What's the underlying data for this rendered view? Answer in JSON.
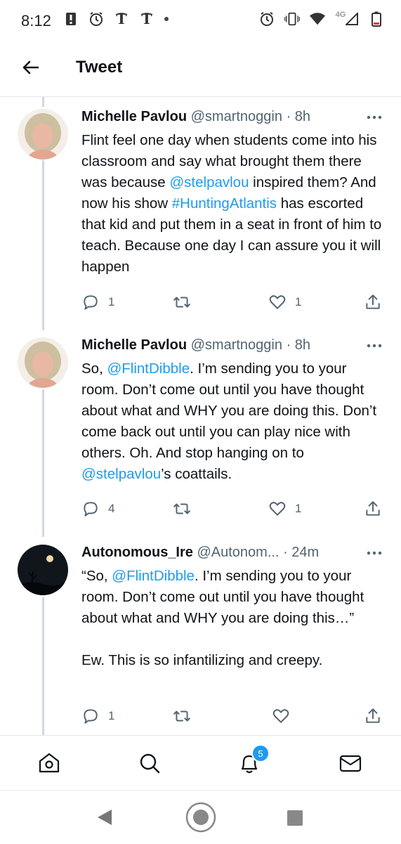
{
  "status_bar": {
    "time": "8:12",
    "icons_left": [
      "alert-icon",
      "alarm-icon",
      "nyt-icon",
      "nyt-icon",
      "dot-icon"
    ],
    "icons_right": [
      "alarm-icon",
      "vibrate-icon",
      "wifi-icon",
      "signal-icon",
      "battery-icon"
    ],
    "network": "4G"
  },
  "header": {
    "title": "Tweet",
    "back_icon": "back-arrow-icon"
  },
  "tweets": [
    {
      "name": "Michelle Pavlou",
      "handle": "@smartnoggin",
      "time": "· 8h",
      "text_parts": [
        "Flint feel one day when students come into his classroom and say what brought them there was because ",
        "@stelpavlou",
        " inspired them? And now his show ",
        "#HuntingAtlantis",
        " has escorted that kid and put them in a seat in front of him to teach. Because one day I can assure you it will happen"
      ],
      "replies": "1",
      "retweets": "",
      "likes": "1"
    },
    {
      "name": "Michelle Pavlou",
      "handle": "@smartnoggin",
      "time": "· 8h",
      "text_parts": [
        "So, ",
        "@FlintDibble",
        ". I’m sending you to your room. Don’t come out until you have thought about what and WHY you are doing this. Don’t come back out until you can play nice with others. Oh. And stop hanging on to ",
        "@stelpavlou",
        "’s coattails."
      ],
      "replies": "4",
      "retweets": "",
      "likes": "1"
    },
    {
      "name": "Autonomous_Ire",
      "handle": "@Autonom...",
      "time": "· 24m",
      "text_parts": [
        "“So, ",
        "@FlintDibble",
        ". I’m sending you to your room. Don’t come out until you have thought about what and WHY you are doing this…”\n\nEw. This is so infantilizing and creepy."
      ],
      "replies": "1",
      "retweets": "",
      "likes": ""
    }
  ],
  "bottom_nav": {
    "items": [
      "home-icon",
      "search-icon",
      "notifications-icon",
      "messages-icon"
    ],
    "notification_badge": "5"
  },
  "colors": {
    "link": "#1d9bf0",
    "secondary_text": "#536471",
    "thread_line": "#cfd9de"
  }
}
